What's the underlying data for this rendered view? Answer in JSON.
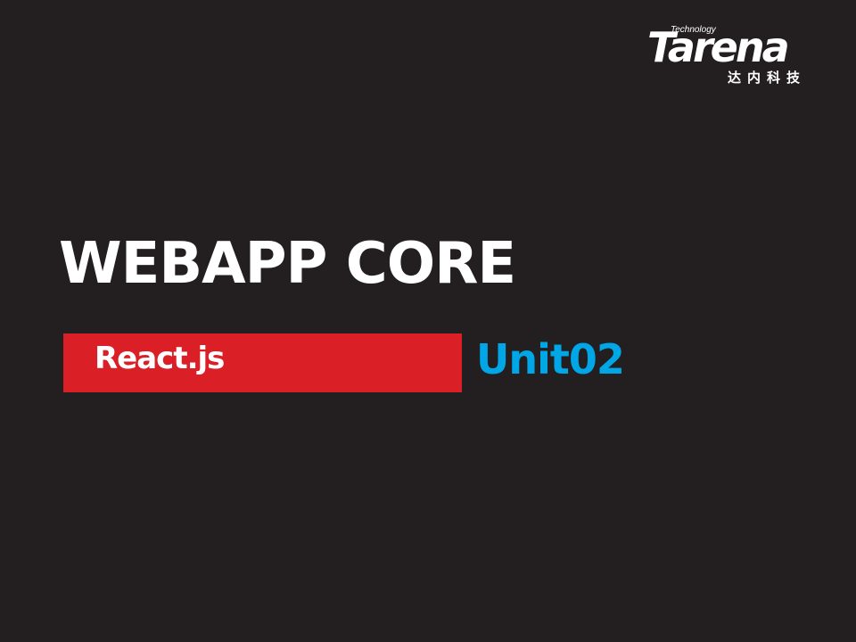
{
  "logo": {
    "technology": "Technology",
    "wordmark": "Tarena",
    "chinese": "达内科技"
  },
  "slide": {
    "title": "WEBAPP CORE",
    "subtitle": "React.js",
    "unit": "Unit02"
  },
  "colors": {
    "background": "#231f20",
    "band": "#da1f26",
    "unit_text": "#00a6e6",
    "text": "#ffffff"
  }
}
